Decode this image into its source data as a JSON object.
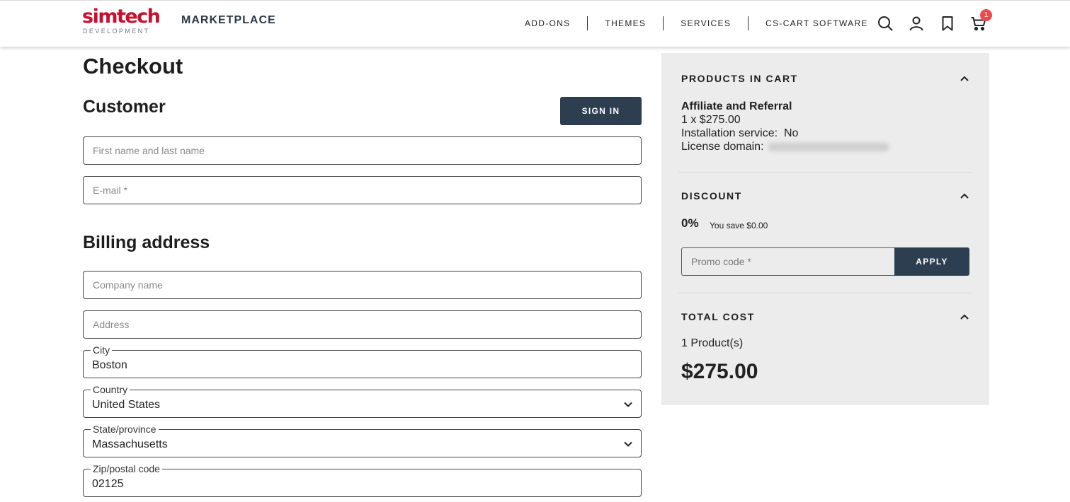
{
  "header": {
    "logo_main": "simtech",
    "logo_sub": "DEVELOPMENT",
    "brand": "MARKETPLACE",
    "nav": [
      "ADD-ONS",
      "THEMES",
      "SERVICES",
      "CS-CART SOFTWARE"
    ],
    "cart_count": "1",
    "icons": [
      "search-icon",
      "user-icon",
      "bookmark-icon",
      "cart-icon"
    ]
  },
  "page": {
    "title": "Checkout"
  },
  "customer": {
    "title": "Customer",
    "sign_in": "SIGN IN",
    "name_placeholder": "First name and last name",
    "email_placeholder": "E-mail *"
  },
  "billing": {
    "title": "Billing address",
    "company_placeholder": "Company name",
    "address_placeholder": "Address",
    "city_label": "City",
    "city_value": "Boston",
    "country_label": "Country",
    "country_value": "United States",
    "state_label": "State/province",
    "state_value": "Massachusetts",
    "zip_label": "Zip/postal code",
    "zip_value": "02125"
  },
  "sidebar": {
    "products_title": "PRODUCTS IN CART",
    "product_name": "Affiliate and Referral",
    "product_qty": "1 x $275.00",
    "installation": "Installation service:  No",
    "license_label": "License domain:",
    "discount_title": "DISCOUNT",
    "discount_value": "0%",
    "discount_save": "You save $0.00",
    "promo_placeholder": "Promo code *",
    "apply": "APPLY",
    "total_title": "TOTAL COST",
    "product_count": "1 Product(s)",
    "total": "$275.00"
  },
  "colors": {
    "brand_red": "#c8102e",
    "dark_button": "#2c3e50",
    "badge": "#e84c4c",
    "sidebar_bg": "#ececec"
  }
}
